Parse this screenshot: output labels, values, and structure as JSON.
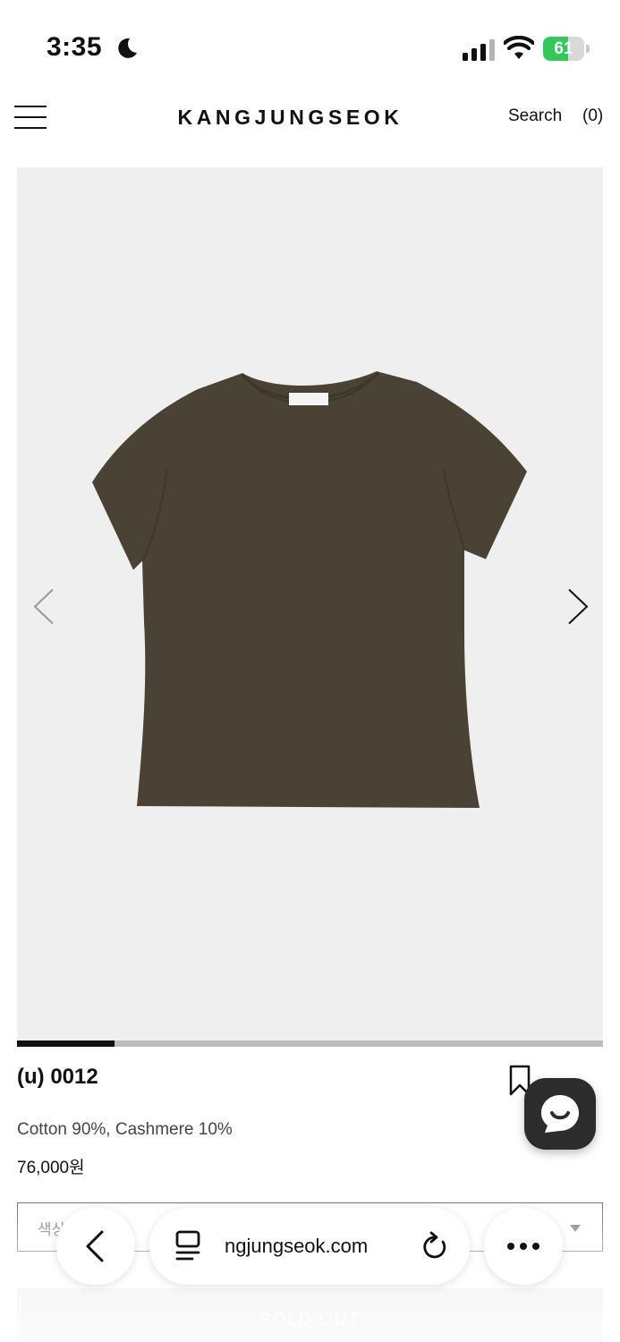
{
  "status_bar": {
    "time": "3:35",
    "battery_level": "61",
    "battery_fraction": 0.61,
    "icons": [
      "moon-icon",
      "signal-icon",
      "wifi-icon",
      "battery-icon"
    ]
  },
  "header": {
    "brand": "KANGJUNGSEOK",
    "search_label": "Search",
    "cart_label": "(0)",
    "icons": [
      "menu-icon"
    ]
  },
  "gallery": {
    "image_description": "brown short-sleeve t-shirt",
    "progress_fraction": 0.167,
    "icons": [
      "chevron-left-icon",
      "chevron-right-icon"
    ]
  },
  "product": {
    "name": "(u) 0012",
    "material": "Cotton 90%, Cashmere 10%",
    "price": "76,000원",
    "option_placeholder": "색상",
    "soldout_label": "SOLD OUT",
    "icons": [
      "bookmark-icon",
      "chat-icon",
      "chevron-down-icon"
    ]
  },
  "browser_toolbar": {
    "url": "ngjungseok.com",
    "icons": [
      "back-icon",
      "tabs-icon",
      "reload-icon",
      "more-icon"
    ]
  },
  "colors": {
    "shirt": "#4a4234",
    "gallery_bg": "#efefef",
    "battery_green": "#34c759",
    "chat_bg": "#2c2c2c"
  }
}
